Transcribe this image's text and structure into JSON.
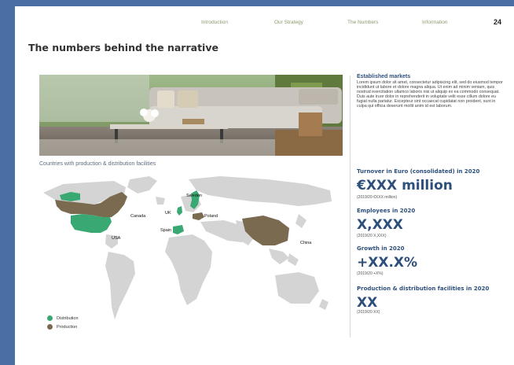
{
  "nav": {
    "items": [
      "Introduction",
      "Our Strategy",
      "The Numbers",
      "Information"
    ],
    "page_number": "24"
  },
  "title": "The numbers behind the narrative",
  "map": {
    "caption": "Countries with production & distribution facilities",
    "labels": [
      "Canada",
      "USA",
      "UK",
      "Sweden",
      "Poland",
      "Spain",
      "China"
    ],
    "legend": [
      {
        "label": "Distribution",
        "color": "#3aa872"
      },
      {
        "label": "Production",
        "color": "#7a6a50"
      }
    ]
  },
  "established": {
    "heading": "Established markets",
    "body": "Lorem ipsum dolor sit amet, consectetur adipiscing elit, sed do eiusmod tempor incididunt ut labore et dolore magna aliqua. Ut enim ad minim veniam, quis nostrud exercitation ullamco laboris nisi ut aliquip ex ea commodo consequat. Duis aute irure dolor in reprehenderit in voluptate velit esse cillum dolore eu fugiat nulla pariatur. Excepteur sint occaecat cupidatat non proident, sunt in culpa qui officia deserunt mollit anim id est laborum."
  },
  "stats": [
    {
      "label": "Turnover in Euro (consolidated) in 2020",
      "value": "€XXX million",
      "note": "(2019/20 €XXX million)"
    },
    {
      "label": "Employees in 2020",
      "value": "X,XXX",
      "note": "(2019/20 X,XXX)"
    },
    {
      "label": "Growth in 2020",
      "value": "+XX.X%",
      "note": "(2019/20 +X%)"
    },
    {
      "label": "Production & distribution facilities in 2020",
      "value": "XX",
      "note": "(2019/20 XX)"
    }
  ],
  "colors": {
    "distribution": "#3aa872",
    "production": "#7a6a50",
    "land": "#d4d4d4",
    "accent": "#2d4f7c",
    "background": "#4a6fa5"
  }
}
